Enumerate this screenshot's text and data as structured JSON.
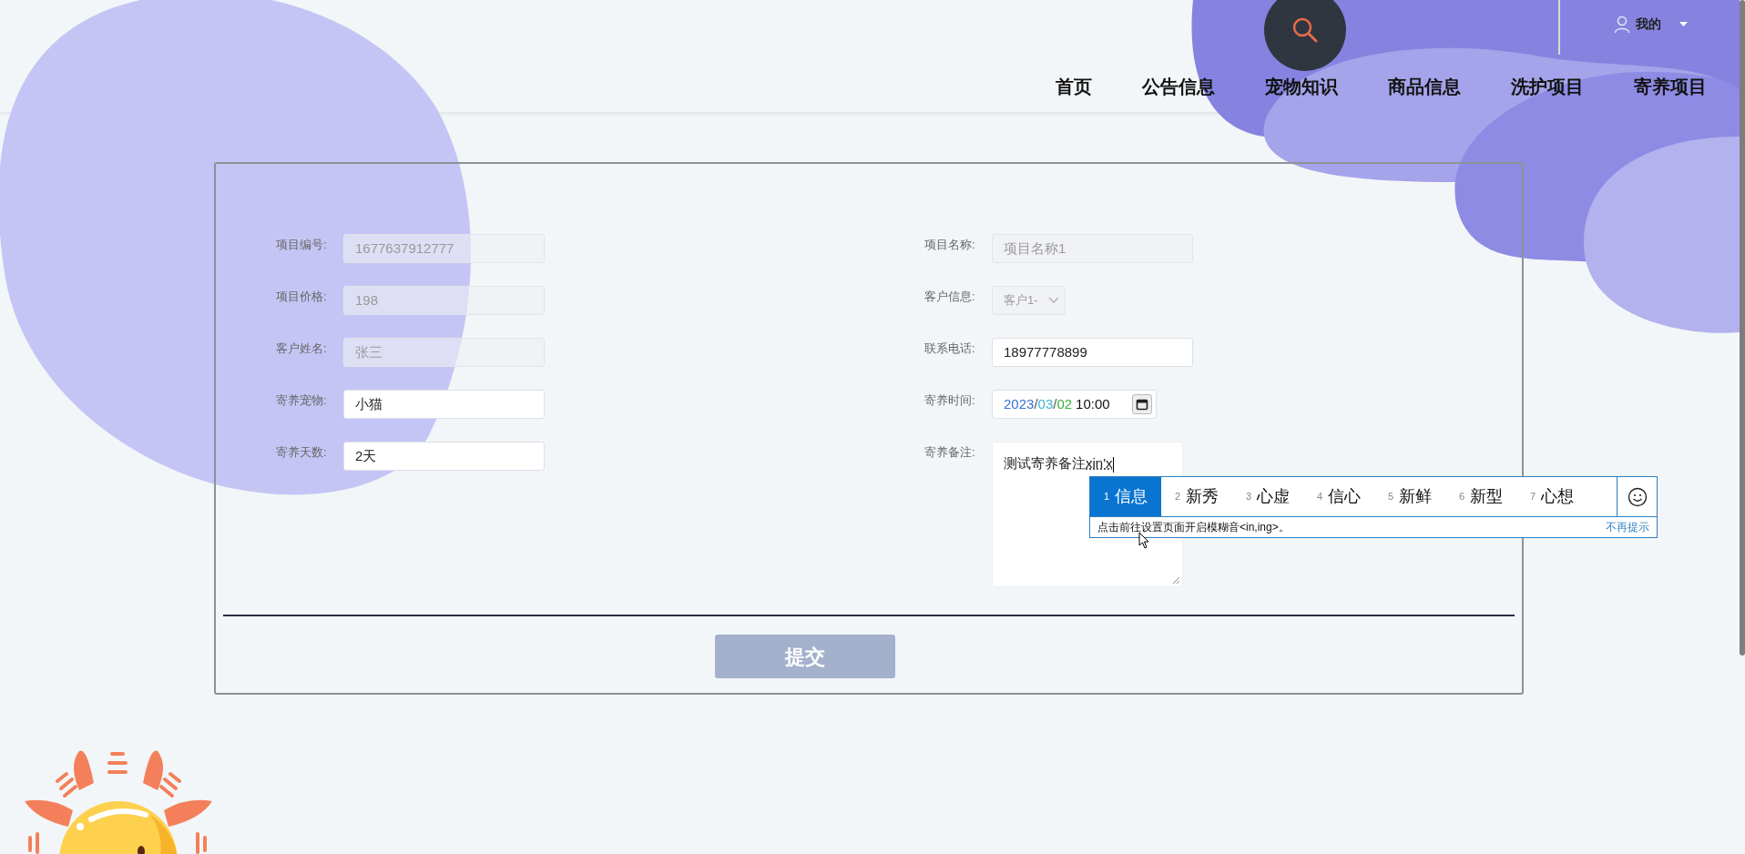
{
  "header": {
    "user_menu": {
      "label": "我的"
    },
    "nav": [
      {
        "label": "首页"
      },
      {
        "label": "公告信息"
      },
      {
        "label": "宠物知识"
      },
      {
        "label": "商品信息"
      },
      {
        "label": "洗护项目"
      },
      {
        "label": "寄养项目"
      }
    ]
  },
  "form": {
    "left_fields": [
      {
        "label": "项目编号:",
        "kind": "text",
        "value": "1677637912777",
        "disabled": true
      },
      {
        "label": "项目价格:",
        "kind": "text",
        "value": "198",
        "disabled": true
      },
      {
        "label": "客户姓名:",
        "kind": "text",
        "value": "张三",
        "disabled": true
      },
      {
        "label": "寄养宠物:",
        "kind": "text",
        "value": "小猫",
        "disabled": false
      },
      {
        "label": "寄养天数:",
        "kind": "text",
        "value": "2天",
        "disabled": false
      }
    ],
    "right_fields": [
      {
        "label": "项目名称:",
        "kind": "text",
        "value": "项目名称1",
        "disabled": true
      },
      {
        "label": "客户信息:",
        "kind": "select",
        "value": "客户1-",
        "disabled": true
      },
      {
        "label": "联系电话:",
        "kind": "text",
        "value": "18977778899",
        "disabled": false
      },
      {
        "label": "寄养时间:",
        "kind": "datetime",
        "segments": [
          {
            "text": "2023",
            "color": "#3a6fd8"
          },
          {
            "text": "/",
            "color": "#555555"
          },
          {
            "text": "03",
            "color": "#38b6d8"
          },
          {
            "text": "/",
            "color": "#555555"
          },
          {
            "text": "02",
            "color": "#3cae3c"
          },
          {
            "text": "10:00",
            "color": "#111111"
          }
        ]
      },
      {
        "label": "寄养备注:",
        "kind": "textarea",
        "value": "测试寄养备注",
        "composition": "xin'x"
      }
    ],
    "submit": {
      "label": "提交"
    }
  },
  "ime": {
    "candidates": [
      {
        "index": "1",
        "text": "信息",
        "selected": true
      },
      {
        "index": "2",
        "text": "新秀",
        "selected": false
      },
      {
        "index": "3",
        "text": "心虚",
        "selected": false
      },
      {
        "index": "4",
        "text": "信心",
        "selected": false
      },
      {
        "index": "5",
        "text": "新鲜",
        "selected": false
      },
      {
        "index": "6",
        "text": "新型",
        "selected": false
      },
      {
        "index": "7",
        "text": "心想",
        "selected": false
      }
    ],
    "hint": "点击前往设置页面开启模糊音<in,ing>。",
    "dismiss": "不再提示"
  }
}
